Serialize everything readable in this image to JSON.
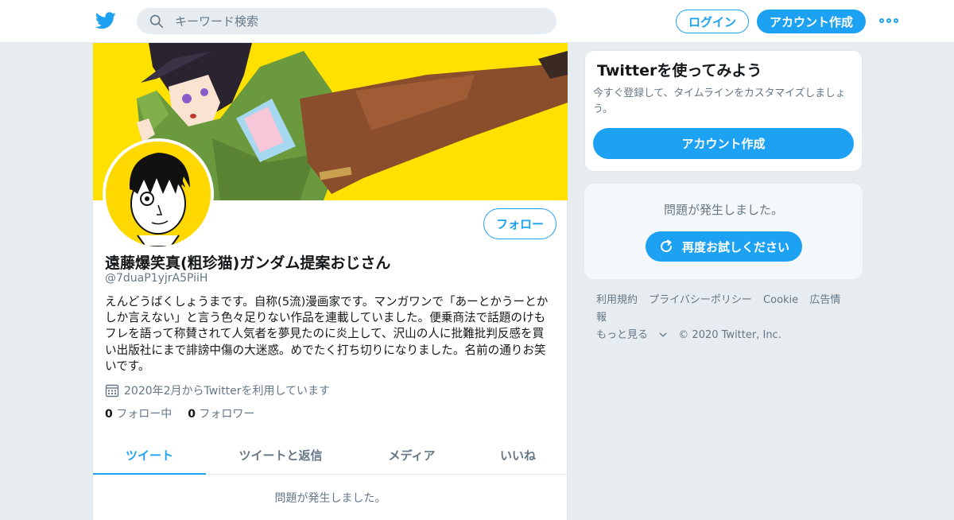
{
  "header": {
    "search_placeholder": "キーワード検索",
    "login_label": "ログイン",
    "signup_label": "アカウント作成",
    "icons": {
      "logo": "twitter-bird-icon",
      "search": "search-icon",
      "more": "more-icon"
    }
  },
  "profile": {
    "follow_label": "フォロー",
    "name": "遠藤爆笑真(粗珍猫)ガンダム提案おじさん",
    "handle": "@7duaP1yjrA5PiiH",
    "bio": "えんどうばくしょうまです。自称(5流)漫画家です。マンガワンで「あーとかうーとかしか言えない」と言う色々足りない作品を連載していました。便乗商法で話題のけもフレを語って称賛されて人気者を夢見たのに炎上して、沢山の人に批難批判反感を買い出版社にまで誹謗中傷の大迷惑。めでたく打ち切りになりました。名前の通りお笑いです。",
    "joined": "2020年2月からTwitterを利用しています",
    "following_count": "0",
    "following_label": "フォロー中",
    "followers_count": "0",
    "followers_label": "フォロワー",
    "tabs": [
      "ツイート",
      "ツイートと返信",
      "メディア",
      "いいね"
    ],
    "error_text": "問題が発生しました。"
  },
  "sidebar": {
    "signup_card": {
      "title": "Twitterを使ってみよう",
      "text": "今すぐ登録して、タイムラインをカスタマイズしましょう。",
      "button_label": "アカウント作成"
    },
    "error_card": {
      "message": "問題が発生しました。",
      "retry_label": "再度お試しください"
    },
    "footer": {
      "links": [
        "利用規約",
        "プライバシーポリシー",
        "Cookie",
        "広告情報"
      ],
      "more_label": "もっと見る",
      "copyright": "© 2020 Twitter, Inc."
    }
  },
  "colors": {
    "accent": "#1da1f2",
    "background": "#e6ecf0",
    "muted_text": "#657786",
    "banner_yellow": "#ffe100"
  }
}
